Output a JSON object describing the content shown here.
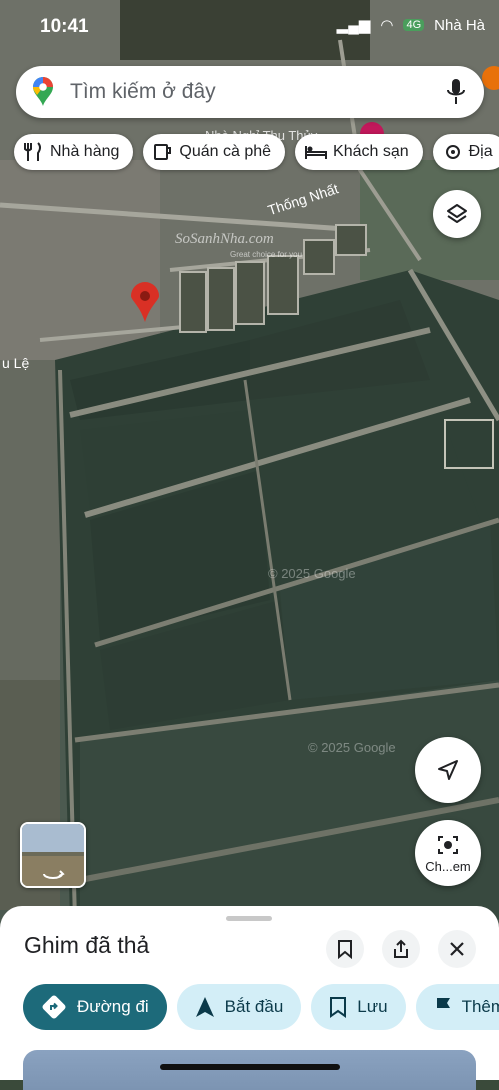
{
  "status": {
    "time": "10:41",
    "network": "4G"
  },
  "search": {
    "placeholder": "Tìm kiếm ở đây"
  },
  "chips": [
    {
      "label": "Nhà hàng",
      "icon": "fork-knife-icon"
    },
    {
      "label": "Quán cà phê",
      "icon": "coffee-cup-icon"
    },
    {
      "label": "Khách sạn",
      "icon": "bed-icon"
    },
    {
      "label": "Địa",
      "icon": "landmark-icon"
    }
  ],
  "map": {
    "labels": {
      "street": "Thống Nhất",
      "top_right": "Nhà Hà",
      "left_edge": "u Lệ",
      "poi": "Nhà Nghỉ Thu Thủy"
    },
    "watermark": {
      "brand": "SoSanhNha.com",
      "tagline": "Great choice for you"
    },
    "copyright": "© 2025 Google"
  },
  "buttons": {
    "lens_label": "Ch...em"
  },
  "sheet": {
    "title": "Ghim đã thả",
    "actions": [
      {
        "label": "Đường đi",
        "icon": "directions-icon"
      },
      {
        "label": "Bắt đầu",
        "icon": "navigation-arrow-icon"
      },
      {
        "label": "Lưu",
        "icon": "bookmark-icon"
      },
      {
        "label": "Thêm",
        "icon": "flag-icon"
      }
    ]
  },
  "colors": {
    "pin": "#d93025",
    "primary_action": "#1d6a7a",
    "action_bg": "#d3eef7",
    "water_dark": "#2b3b33"
  }
}
